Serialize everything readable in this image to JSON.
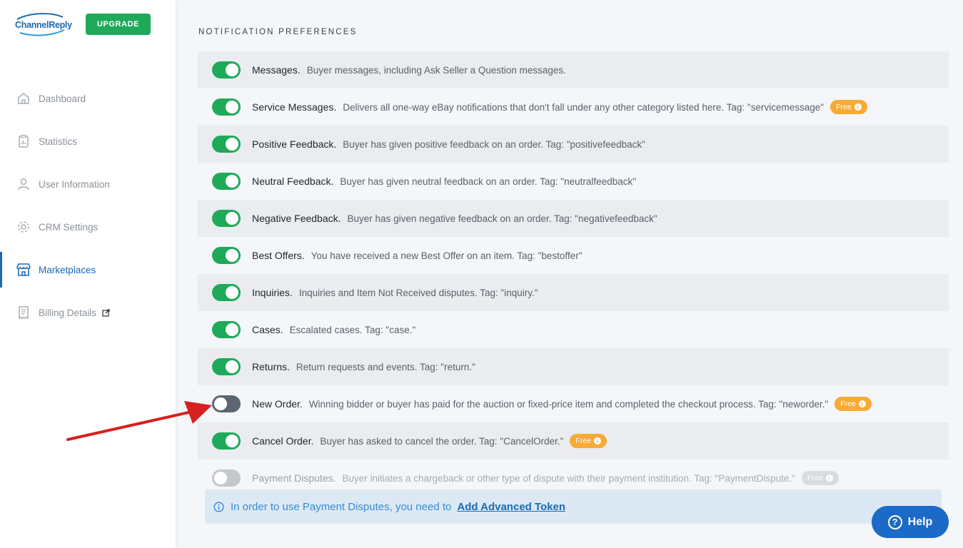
{
  "brand": {
    "logo_text": "ChannelReply",
    "upgrade_label": "UPGRADE",
    "brand_color": "#1b6ab3",
    "accent_green": "#1faa59"
  },
  "sidebar": {
    "items": [
      {
        "label": "Dashboard",
        "icon": "home-icon",
        "active": false
      },
      {
        "label": "Statistics",
        "icon": "clipboard-chart-icon",
        "active": false
      },
      {
        "label": "User Information",
        "icon": "user-icon",
        "active": false
      },
      {
        "label": "CRM Settings",
        "icon": "gear-icon",
        "active": false
      },
      {
        "label": "Marketplaces",
        "icon": "store-icon",
        "active": true
      },
      {
        "label": "Billing Details",
        "icon": "receipt-icon",
        "active": false,
        "external": true
      }
    ]
  },
  "main": {
    "section_title": "NOTIFICATION PREFERENCES",
    "rows": [
      {
        "name": "Messages.",
        "desc": "Buyer messages, including Ask Seller a Question messages.",
        "enabled": true
      },
      {
        "name": "Service Messages.",
        "desc": "Delivers all one-way eBay notifications that don't fall under any other category listed here. Tag: \"servicemessage\"",
        "enabled": true,
        "badge": "Free"
      },
      {
        "name": "Positive Feedback.",
        "desc": "Buyer has given positive feedback on an order. Tag: \"positivefeedback\"",
        "enabled": true
      },
      {
        "name": "Neutral Feedback.",
        "desc": "Buyer has given neutral feedback on an order. Tag: \"neutralfeedback\"",
        "enabled": true
      },
      {
        "name": "Negative Feedback.",
        "desc": "Buyer has given negative feedback on an order. Tag: \"negativefeedback\"",
        "enabled": true
      },
      {
        "name": "Best Offers.",
        "desc": "You have received a new Best Offer on an item. Tag: \"bestoffer\"",
        "enabled": true
      },
      {
        "name": "Inquiries.",
        "desc": "Inquiries and Item Not Received disputes. Tag: \"inquiry.\"",
        "enabled": true
      },
      {
        "name": "Cases.",
        "desc": "Escalated cases. Tag: \"case.\"",
        "enabled": true
      },
      {
        "name": "Returns.",
        "desc": "Return requests and events. Tag: \"return.\"",
        "enabled": true
      },
      {
        "name": "New Order.",
        "desc": "Winning bidder or buyer has paid for the auction or fixed-price item and completed the checkout process. Tag: \"neworder.\"",
        "enabled": false,
        "badge": "Free"
      },
      {
        "name": "Cancel Order.",
        "desc": "Buyer has asked to cancel the order. Tag: \"CancelOrder.\"",
        "enabled": true,
        "badge": "Free"
      },
      {
        "name": "Payment Disputes.",
        "desc": "Buyer initiates a chargeback or other type of dispute with their payment institution. Tag: \"PaymentDispute.\"",
        "enabled": false,
        "disabled": true,
        "badge": "Free"
      }
    ],
    "info": {
      "text": "In order to use Payment Disputes, you need to",
      "link": "Add Advanced Token"
    }
  },
  "help_button": {
    "label": "Help"
  }
}
